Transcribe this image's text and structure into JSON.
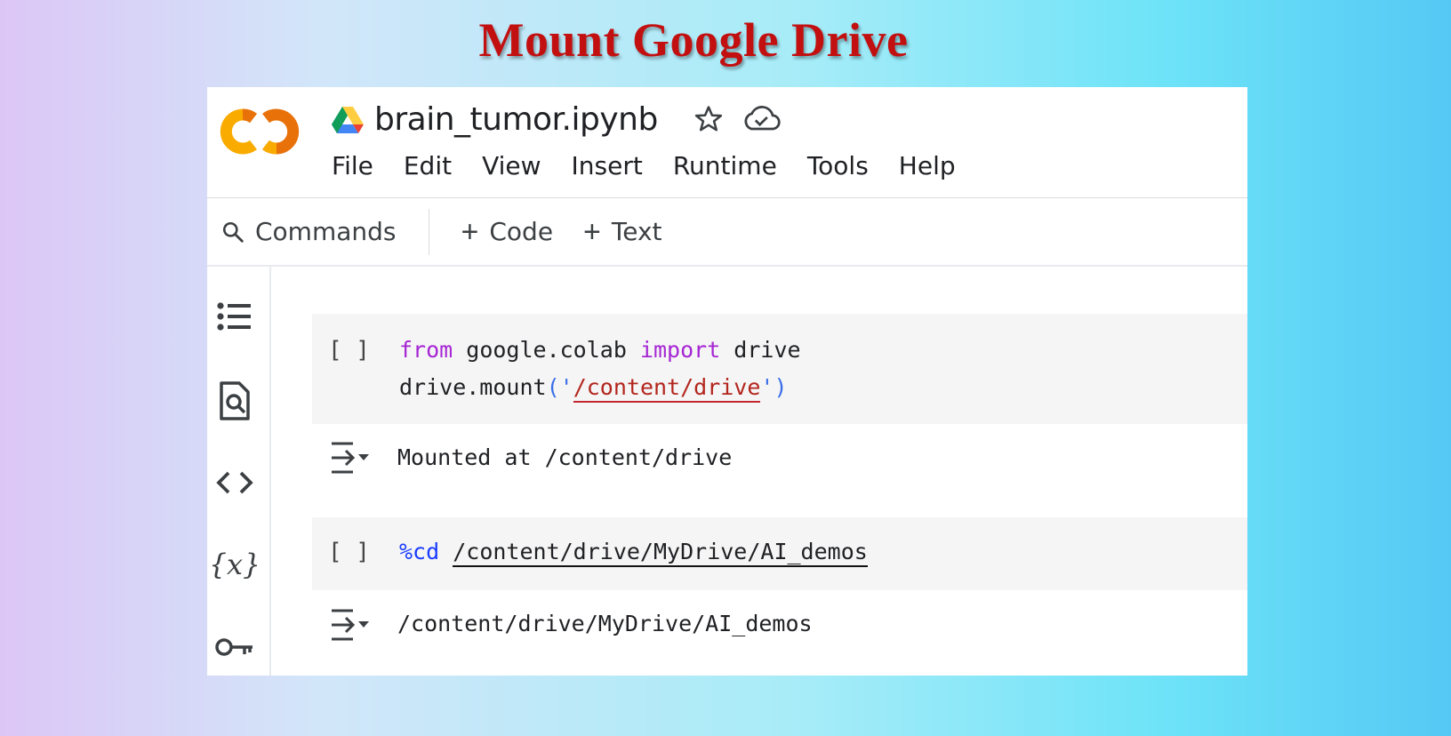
{
  "slide": {
    "title": "Mount Google Drive"
  },
  "header": {
    "filename": "brain_tumor.ipynb",
    "menu": [
      "File",
      "Edit",
      "View",
      "Insert",
      "Runtime",
      "Tools",
      "Help"
    ]
  },
  "toolbar": {
    "commands_label": "Commands",
    "add_code_label": "Code",
    "add_text_label": "Text"
  },
  "sidebar": {
    "icons": [
      "table-of-contents-icon",
      "find-replace-icon",
      "code-snippets-icon",
      "variables-icon",
      "secrets-key-icon"
    ]
  },
  "cells": [
    {
      "bracket": "[ ]",
      "line1": {
        "kw_from": "from",
        "module": " google.colab ",
        "kw_import": "import",
        "name": " drive"
      },
      "line2": {
        "call": "drive.mount",
        "open": "('",
        "path": "/content/drive",
        "close": "')"
      },
      "output": "Mounted at /content/drive"
    },
    {
      "bracket": "[ ]",
      "magic": "%cd",
      "path": "/content/drive/MyDrive/AI_demos",
      "output": "/content/drive/MyDrive/AI_demos"
    }
  ],
  "colors": {
    "title": "#c21010",
    "keyword": "#a626d4",
    "magic": "#1a3cff",
    "string": "#b3261e",
    "colab_orange": "#f9ab00"
  }
}
